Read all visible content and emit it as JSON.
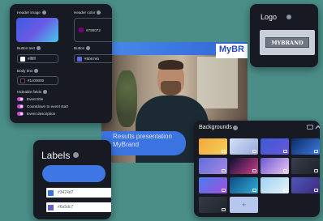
{
  "settings": {
    "header_image_label": "Header image",
    "header_color_label": "Header color",
    "header_color_value": "#790072",
    "header_color_hex": "#790072",
    "button_text_label": "Button text",
    "button_text_value": "#ffffff",
    "button_text_hex": "#ffffff",
    "button_label": "Button",
    "button_value": "#5b67eb",
    "button_hex": "#5b67eb",
    "body_text_label": "Body text",
    "body_text_value": "#1c00000",
    "body_text_hex": "#1c0000",
    "hideable_fields_label": "Hideable fields",
    "toggles": [
      {
        "label": "Event title"
      },
      {
        "label": "Countdown to event start"
      },
      {
        "label": "Event description"
      }
    ]
  },
  "video": {
    "brand_text": "MyBR",
    "caption_line1": "Results presentation",
    "caption_line2": "MyBrand"
  },
  "logo": {
    "title": "Logo",
    "wordmark": "MYBRAND"
  },
  "labels": {
    "title": "Labels",
    "colors": [
      {
        "value": "#3474d7",
        "hex": "#3474d7"
      },
      {
        "value": "#6a5dc7",
        "hex": "#6a5dc7"
      }
    ]
  },
  "backgrounds": {
    "title": "Backgrounds",
    "add_symbol": "+",
    "tiles": [
      {
        "style": "linear-gradient(135deg,#f1a83a,#f6cf5a)"
      },
      {
        "style": "linear-gradient(135deg,#d6dff5,#93a8dc)"
      },
      {
        "style": "linear-gradient(135deg,#3b5bd6,#6a56d8)"
      },
      {
        "style": "linear-gradient(135deg,#0f2a66,#3a7be0)"
      },
      {
        "style": "linear-gradient(135deg,#5d6fd8,#a987e6)"
      },
      {
        "style": "linear-gradient(135deg,#0b0f33,#cf3f8a)"
      },
      {
        "style": "linear-gradient(135deg,#6c58d6,#ecc6ee)"
      },
      {
        "style": "linear-gradient(135deg,#3a3f4b,#1c1f27)"
      },
      {
        "style": "linear-gradient(135deg,#4a7df0,#a14fd8)"
      },
      {
        "style": "linear-gradient(135deg,#0d4a86,#32b0d6)"
      },
      {
        "style": "linear-gradient(135deg,#9ed2f0,#e6f4fb)"
      },
      {
        "style": "linear-gradient(135deg,#4f56b8,#3c2a7d)"
      },
      {
        "style": "linear-gradient(135deg,#343a46,#20242c)"
      }
    ]
  }
}
